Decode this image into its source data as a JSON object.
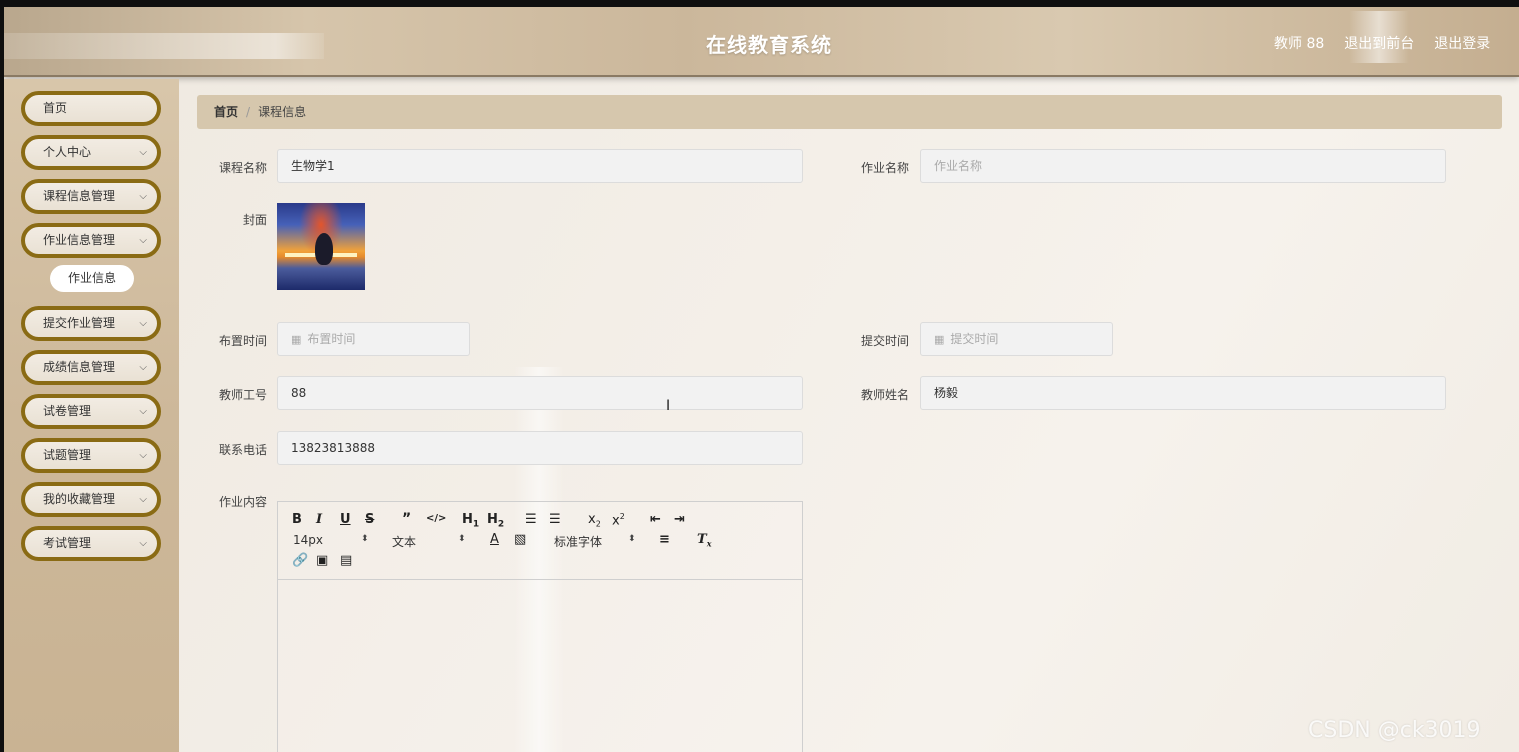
{
  "header": {
    "title": "在线教育系统",
    "user_label": "教师 88",
    "front_link": "退出到前台",
    "logout_link": "退出登录"
  },
  "sidebar": {
    "items": [
      {
        "label": "首页",
        "has_arrow": false
      },
      {
        "label": "个人中心",
        "has_arrow": true
      },
      {
        "label": "课程信息管理",
        "has_arrow": true
      },
      {
        "label": "作业信息管理",
        "has_arrow": true
      },
      {
        "label": "提交作业管理",
        "has_arrow": true
      },
      {
        "label": "成绩信息管理",
        "has_arrow": true
      },
      {
        "label": "试卷管理",
        "has_arrow": true
      },
      {
        "label": "试题管理",
        "has_arrow": true
      },
      {
        "label": "我的收藏管理",
        "has_arrow": true
      },
      {
        "label": "考试管理",
        "has_arrow": true
      }
    ],
    "sub_item": "作业信息"
  },
  "breadcrumb": {
    "home": "首页",
    "separator": "/",
    "current": "课程信息"
  },
  "form": {
    "course_name": {
      "label": "课程名称",
      "value": "生物学1"
    },
    "homework_name": {
      "label": "作业名称",
      "value": "",
      "placeholder": "作业名称"
    },
    "cover": {
      "label": "封面"
    },
    "assign_time": {
      "label": "布置时间",
      "value": "",
      "placeholder": "布置时间"
    },
    "submit_time": {
      "label": "提交时间",
      "value": "",
      "placeholder": "提交时间"
    },
    "teacher_id": {
      "label": "教师工号",
      "value": "88"
    },
    "teacher_name": {
      "label": "教师姓名",
      "value": "杨毅"
    },
    "phone": {
      "label": "联系电话",
      "value": "13823813888"
    },
    "content": {
      "label": "作业内容"
    }
  },
  "editor": {
    "buttons_row1": [
      "B",
      "I",
      "U",
      "S",
      "99",
      "</>",
      "H1",
      "H2",
      "ol",
      "ul",
      "x2-sub",
      "x2-sup",
      "outdent",
      "indent"
    ],
    "font_size": "14px",
    "block_type": "文本",
    "font_family": "标准字体"
  },
  "watermark": "CSDN @ck3019"
}
